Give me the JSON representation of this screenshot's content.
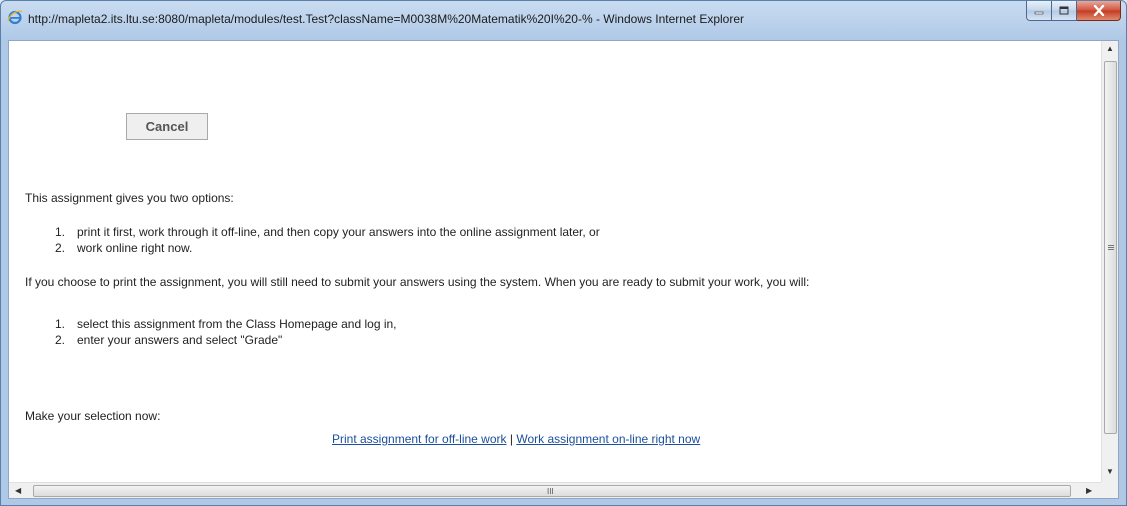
{
  "window": {
    "title": "http://mapleta2.its.ltu.se:8080/mapleta/modules/test.Test?className=M0038M%20Matematik%20I%20-% - Windows Internet Explorer"
  },
  "page": {
    "cancel_label": "Cancel",
    "intro": "This assignment gives you two options:",
    "options": [
      {
        "num": "1.",
        "text": "print it first, work through it off-line, and then copy your answers into the online assignment later, or"
      },
      {
        "num": "2.",
        "text": "work online right now."
      }
    ],
    "print_note": "If you choose to print the assignment, you will still need to submit your answers using the system. When you are ready to submit your work, you will:",
    "steps": [
      {
        "num": "1.",
        "text": "select this assignment from the Class Homepage and log in,"
      },
      {
        "num": "2.",
        "text": "enter your answers and select \"Grade\""
      }
    ],
    "prompt": "Make your selection now:",
    "link_print": "Print assignment for off-line work",
    "link_separator": "|",
    "link_online": "Work assignment on-line right now"
  },
  "icons": {
    "app": "internet-explorer-icon",
    "minimize": "minimize-icon",
    "maximize": "maximize-icon",
    "close": "close-icon"
  },
  "scrollbar": {
    "horizontal_grip": "III"
  },
  "colors": {
    "link": "#1a4f9c",
    "close_button": "#c43a22"
  }
}
